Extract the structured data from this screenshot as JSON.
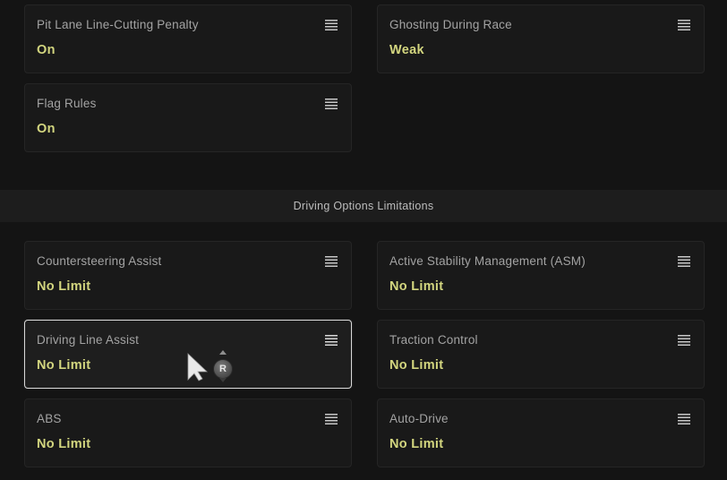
{
  "race_settings": [
    {
      "label": "Pit Lane Line-Cutting Penalty",
      "value": "On"
    },
    {
      "label": "Ghosting During Race",
      "value": "Weak"
    },
    {
      "label": "Flag Rules",
      "value": "On"
    }
  ],
  "section": {
    "title": "Driving Options Limitations"
  },
  "driving_options": [
    {
      "label": "Countersteering Assist",
      "value": "No Limit"
    },
    {
      "label": "Active Stability Management (ASM)",
      "value": "No Limit"
    },
    {
      "label": "Driving Line Assist",
      "value": "No Limit"
    },
    {
      "label": "Traction Control",
      "value": "No Limit"
    },
    {
      "label": "ABS",
      "value": "No Limit"
    },
    {
      "label": "Auto-Drive",
      "value": "No Limit"
    }
  ],
  "cursor": {
    "badge_label": "R"
  },
  "colors": {
    "value_accent": "#d3d67f",
    "label": "#a3a3a3",
    "background": "#141414",
    "selected_border": "#d9d9d9"
  },
  "icons": {
    "option_menu": "menu-lines-icon",
    "pointer": "cursor-arrow-icon"
  }
}
